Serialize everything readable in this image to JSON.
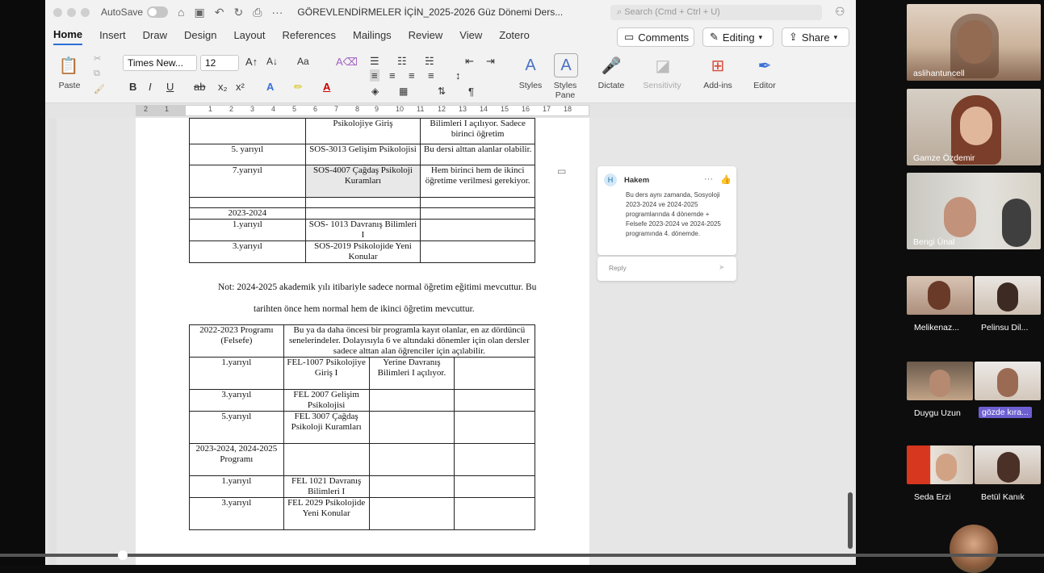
{
  "titlebar": {
    "autosave_label": "AutoSave",
    "document_title": "GÖREVLENDİRMELER İÇİN_2025-2026 Güz Dönemi Ders...",
    "search_placeholder": "Search (Cmd + Ctrl + U)"
  },
  "ribbon_tabs": [
    "Home",
    "Insert",
    "Draw",
    "Design",
    "Layout",
    "References",
    "Mailings",
    "Review",
    "View",
    "Zotero"
  ],
  "ribbon_buttons": {
    "comments": "Comments",
    "editing": "Editing",
    "share": "Share"
  },
  "ribbon": {
    "paste": "Paste",
    "font_name": "Times New...",
    "font_size": "12",
    "styles": "Styles",
    "styles_pane_1": "Styles",
    "styles_pane_2": "Pane",
    "dictate": "Dictate",
    "sensitivity": "Sensitivity",
    "add_ins": "Add-ins",
    "editor": "Editor"
  },
  "ruler_numbers": [
    "2",
    "1",
    "1",
    "2",
    "3",
    "4",
    "5",
    "6",
    "7",
    "8",
    "9",
    "10",
    "11",
    "12",
    "13",
    "14",
    "15",
    "16",
    "17",
    "18"
  ],
  "table1": {
    "r0": [
      "",
      "Psikolojiye Giriş",
      "Bilimleri I açılıyor. Sadece birinci öğretim"
    ],
    "r1": [
      "5. yarıyıl",
      "SOS-3013 Gelişim Psikolojisi",
      "Bu dersi alttan alanlar olabilir."
    ],
    "r2": [
      "7.yarıyıl",
      "SOS-4007 Çağdaş Psikoloji Kuramları",
      "Hem birinci hem de ikinci öğretime verilmesi gerekiyor."
    ],
    "r3": [
      "",
      "",
      ""
    ],
    "r4": [
      "2023-2024",
      "",
      ""
    ],
    "r5": [
      "1.yarıyıl",
      "SOS- 1013 Davranış Bilimleri I",
      ""
    ],
    "r6": [
      "3.yarıyıl",
      "SOS-2019 Psikolojide Yeni Konular",
      ""
    ]
  },
  "note_line1": "Not: 2024-2025 akademik yılı itibariyle sadece normal öğretim eğitimi mevcuttur. Bu",
  "note_line2": "tarihten önce hem normal hem de ikinci öğretim mevcuttur.",
  "table2": {
    "header_left": "2022-2023 Programı (Felsefe)",
    "header_right": "Bu ya da daha öncesi bir programla kayıt olanlar, en az dördüncü senelerindeler. Dolayısıyla 6 ve altındaki dönemler için olan dersler sadece alttan alan öğrenciler için açılabilir.",
    "rows": [
      [
        "1.yarıyıl",
        "FEL-1007 Psikolojiye Giriş I",
        "Yerine Davranış Bilimleri I açılıyor.",
        ""
      ],
      [
        "3.yarıyıl",
        "FEL 2007 Gelişim Psikolojisi",
        "",
        ""
      ],
      [
        "5.yarıyıl",
        "FEL 3007 Çağdaş Psikoloji Kuramları",
        "",
        ""
      ],
      [
        "2023-2024, 2024-2025 Programı",
        "",
        "",
        ""
      ],
      [
        "1.yarıyıl",
        "FEL 1021 Davranış Bilimleri I",
        "",
        ""
      ],
      [
        "3.yarıyıl",
        "FEL 2029 Psikolojide Yeni Konular",
        "",
        ""
      ]
    ]
  },
  "comment": {
    "avatar_letter": "H",
    "author": "Hakem",
    "text": "Bu ders aynı zamanda, Sosyoloji 2023-2024 ve 2024-2025 programlarında 4 dönemde + Felsefe 2023-2024 ve 2024-2025 programında 4. dönemde.",
    "reply_placeholder": "Reply"
  },
  "participants": [
    {
      "name": "aslihantuncell"
    },
    {
      "name": "Gamze Özdemir"
    },
    {
      "name": "Bengi Ünal"
    },
    {
      "name": "Melikenaz..."
    },
    {
      "name": "Pelinsu Dil..."
    },
    {
      "name": "Duygu Uzun"
    },
    {
      "name": "gözde kıra..."
    },
    {
      "name": "Seda Erzi"
    },
    {
      "name": "Betül Kanık"
    }
  ]
}
